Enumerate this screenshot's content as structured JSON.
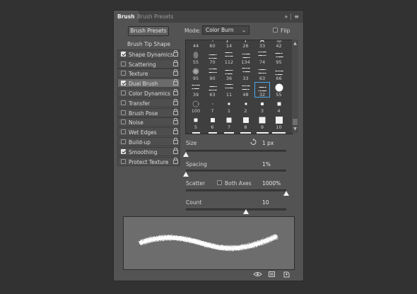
{
  "tabs": [
    {
      "label": "Brush",
      "active": true
    },
    {
      "label": "Brush Presets",
      "active": false
    }
  ],
  "tab_icons": [
    "expand-arrows-icon",
    "panel-menu-icon"
  ],
  "header": {
    "presets_button": "Brush Presets",
    "mode_label": "Mode:",
    "mode_value": "Color Burn",
    "flip_label": "Flip",
    "flip_checked": false
  },
  "options": {
    "heading": "Brush Tip Shape",
    "items": [
      {
        "label": "Shape Dynamics",
        "checked": true,
        "selected": false
      },
      {
        "label": "Scattering",
        "checked": false,
        "selected": false
      },
      {
        "label": "Texture",
        "checked": false,
        "selected": false
      },
      {
        "label": "Dual Brush",
        "checked": true,
        "selected": true
      },
      {
        "label": "Color Dynamics",
        "checked": false,
        "selected": false
      },
      {
        "label": "Transfer",
        "checked": false,
        "selected": false
      },
      {
        "label": "Brush Pose",
        "checked": false,
        "selected": false
      },
      {
        "label": "Noise",
        "checked": false,
        "selected": false
      },
      {
        "label": "Wet Edges",
        "checked": false,
        "selected": false
      },
      {
        "label": "Build-up",
        "checked": false,
        "selected": false
      },
      {
        "label": "Smoothing",
        "checked": true,
        "selected": false
      },
      {
        "label": "Protect Texture",
        "checked": false,
        "selected": false
      }
    ]
  },
  "brush_grid": {
    "rows": [
      [
        "44",
        "60",
        "14",
        "26",
        "33",
        "42"
      ],
      [
        "55",
        "70",
        "112",
        "134",
        "74",
        "95"
      ],
      [
        "95",
        "90",
        "36",
        "33",
        "63",
        "66"
      ],
      [
        "39",
        "63",
        "11",
        "48",
        "32",
        "55"
      ],
      [
        "100",
        "7",
        "1",
        "2",
        "3",
        "4"
      ],
      [
        "5",
        "6",
        "7",
        "8",
        "9",
        "10"
      ]
    ],
    "selected": "32"
  },
  "controls": {
    "size": {
      "label": "Size",
      "value": "1 px",
      "level": 0.0
    },
    "spacing": {
      "label": "Spacing",
      "value": "1%",
      "level": 0.0
    },
    "scatter": {
      "label": "Scatter",
      "both_axes_label": "Both Axes",
      "both_axes_checked": false,
      "value": "1000%",
      "level": 1.0
    },
    "count": {
      "label": "Count",
      "value": "10",
      "level": 0.6
    }
  },
  "bottom_icons": [
    "eye-toggle-icon",
    "brush-grid-icon",
    "new-preset-icon"
  ]
}
